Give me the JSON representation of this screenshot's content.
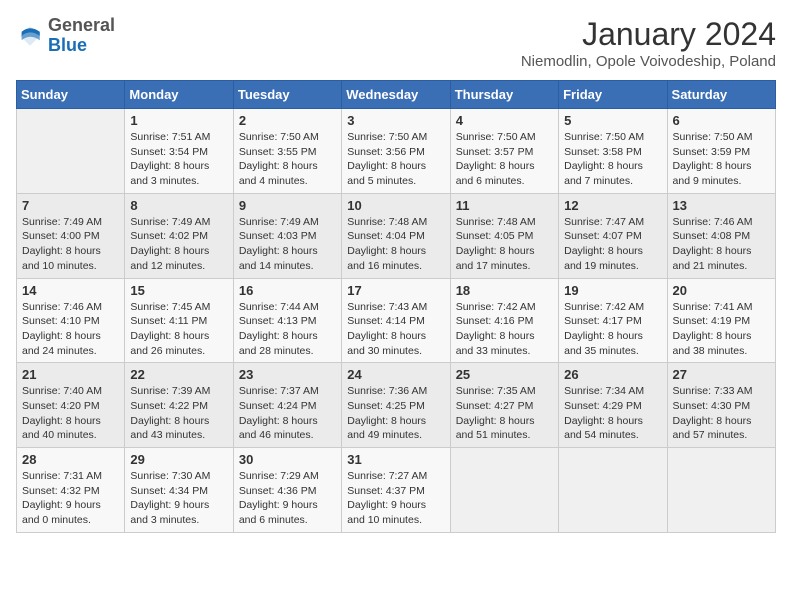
{
  "header": {
    "logo": {
      "general": "General",
      "blue": "Blue"
    },
    "title": "January 2024",
    "subtitle": "Niemodlin, Opole Voivodeship, Poland"
  },
  "weekdays": [
    "Sunday",
    "Monday",
    "Tuesday",
    "Wednesday",
    "Thursday",
    "Friday",
    "Saturday"
  ],
  "weeks": [
    [
      {
        "day": "",
        "sunrise": "",
        "sunset": "",
        "daylight": ""
      },
      {
        "day": "1",
        "sunrise": "Sunrise: 7:51 AM",
        "sunset": "Sunset: 3:54 PM",
        "daylight": "Daylight: 8 hours and 3 minutes."
      },
      {
        "day": "2",
        "sunrise": "Sunrise: 7:50 AM",
        "sunset": "Sunset: 3:55 PM",
        "daylight": "Daylight: 8 hours and 4 minutes."
      },
      {
        "day": "3",
        "sunrise": "Sunrise: 7:50 AM",
        "sunset": "Sunset: 3:56 PM",
        "daylight": "Daylight: 8 hours and 5 minutes."
      },
      {
        "day": "4",
        "sunrise": "Sunrise: 7:50 AM",
        "sunset": "Sunset: 3:57 PM",
        "daylight": "Daylight: 8 hours and 6 minutes."
      },
      {
        "day": "5",
        "sunrise": "Sunrise: 7:50 AM",
        "sunset": "Sunset: 3:58 PM",
        "daylight": "Daylight: 8 hours and 7 minutes."
      },
      {
        "day": "6",
        "sunrise": "Sunrise: 7:50 AM",
        "sunset": "Sunset: 3:59 PM",
        "daylight": "Daylight: 8 hours and 9 minutes."
      }
    ],
    [
      {
        "day": "7",
        "sunrise": "Sunrise: 7:49 AM",
        "sunset": "Sunset: 4:00 PM",
        "daylight": "Daylight: 8 hours and 10 minutes."
      },
      {
        "day": "8",
        "sunrise": "Sunrise: 7:49 AM",
        "sunset": "Sunset: 4:02 PM",
        "daylight": "Daylight: 8 hours and 12 minutes."
      },
      {
        "day": "9",
        "sunrise": "Sunrise: 7:49 AM",
        "sunset": "Sunset: 4:03 PM",
        "daylight": "Daylight: 8 hours and 14 minutes."
      },
      {
        "day": "10",
        "sunrise": "Sunrise: 7:48 AM",
        "sunset": "Sunset: 4:04 PM",
        "daylight": "Daylight: 8 hours and 16 minutes."
      },
      {
        "day": "11",
        "sunrise": "Sunrise: 7:48 AM",
        "sunset": "Sunset: 4:05 PM",
        "daylight": "Daylight: 8 hours and 17 minutes."
      },
      {
        "day": "12",
        "sunrise": "Sunrise: 7:47 AM",
        "sunset": "Sunset: 4:07 PM",
        "daylight": "Daylight: 8 hours and 19 minutes."
      },
      {
        "day": "13",
        "sunrise": "Sunrise: 7:46 AM",
        "sunset": "Sunset: 4:08 PM",
        "daylight": "Daylight: 8 hours and 21 minutes."
      }
    ],
    [
      {
        "day": "14",
        "sunrise": "Sunrise: 7:46 AM",
        "sunset": "Sunset: 4:10 PM",
        "daylight": "Daylight: 8 hours and 24 minutes."
      },
      {
        "day": "15",
        "sunrise": "Sunrise: 7:45 AM",
        "sunset": "Sunset: 4:11 PM",
        "daylight": "Daylight: 8 hours and 26 minutes."
      },
      {
        "day": "16",
        "sunrise": "Sunrise: 7:44 AM",
        "sunset": "Sunset: 4:13 PM",
        "daylight": "Daylight: 8 hours and 28 minutes."
      },
      {
        "day": "17",
        "sunrise": "Sunrise: 7:43 AM",
        "sunset": "Sunset: 4:14 PM",
        "daylight": "Daylight: 8 hours and 30 minutes."
      },
      {
        "day": "18",
        "sunrise": "Sunrise: 7:42 AM",
        "sunset": "Sunset: 4:16 PM",
        "daylight": "Daylight: 8 hours and 33 minutes."
      },
      {
        "day": "19",
        "sunrise": "Sunrise: 7:42 AM",
        "sunset": "Sunset: 4:17 PM",
        "daylight": "Daylight: 8 hours and 35 minutes."
      },
      {
        "day": "20",
        "sunrise": "Sunrise: 7:41 AM",
        "sunset": "Sunset: 4:19 PM",
        "daylight": "Daylight: 8 hours and 38 minutes."
      }
    ],
    [
      {
        "day": "21",
        "sunrise": "Sunrise: 7:40 AM",
        "sunset": "Sunset: 4:20 PM",
        "daylight": "Daylight: 8 hours and 40 minutes."
      },
      {
        "day": "22",
        "sunrise": "Sunrise: 7:39 AM",
        "sunset": "Sunset: 4:22 PM",
        "daylight": "Daylight: 8 hours and 43 minutes."
      },
      {
        "day": "23",
        "sunrise": "Sunrise: 7:37 AM",
        "sunset": "Sunset: 4:24 PM",
        "daylight": "Daylight: 8 hours and 46 minutes."
      },
      {
        "day": "24",
        "sunrise": "Sunrise: 7:36 AM",
        "sunset": "Sunset: 4:25 PM",
        "daylight": "Daylight: 8 hours and 49 minutes."
      },
      {
        "day": "25",
        "sunrise": "Sunrise: 7:35 AM",
        "sunset": "Sunset: 4:27 PM",
        "daylight": "Daylight: 8 hours and 51 minutes."
      },
      {
        "day": "26",
        "sunrise": "Sunrise: 7:34 AM",
        "sunset": "Sunset: 4:29 PM",
        "daylight": "Daylight: 8 hours and 54 minutes."
      },
      {
        "day": "27",
        "sunrise": "Sunrise: 7:33 AM",
        "sunset": "Sunset: 4:30 PM",
        "daylight": "Daylight: 8 hours and 57 minutes."
      }
    ],
    [
      {
        "day": "28",
        "sunrise": "Sunrise: 7:31 AM",
        "sunset": "Sunset: 4:32 PM",
        "daylight": "Daylight: 9 hours and 0 minutes."
      },
      {
        "day": "29",
        "sunrise": "Sunrise: 7:30 AM",
        "sunset": "Sunset: 4:34 PM",
        "daylight": "Daylight: 9 hours and 3 minutes."
      },
      {
        "day": "30",
        "sunrise": "Sunrise: 7:29 AM",
        "sunset": "Sunset: 4:36 PM",
        "daylight": "Daylight: 9 hours and 6 minutes."
      },
      {
        "day": "31",
        "sunrise": "Sunrise: 7:27 AM",
        "sunset": "Sunset: 4:37 PM",
        "daylight": "Daylight: 9 hours and 10 minutes."
      },
      {
        "day": "",
        "sunrise": "",
        "sunset": "",
        "daylight": ""
      },
      {
        "day": "",
        "sunrise": "",
        "sunset": "",
        "daylight": ""
      },
      {
        "day": "",
        "sunrise": "",
        "sunset": "",
        "daylight": ""
      }
    ]
  ]
}
